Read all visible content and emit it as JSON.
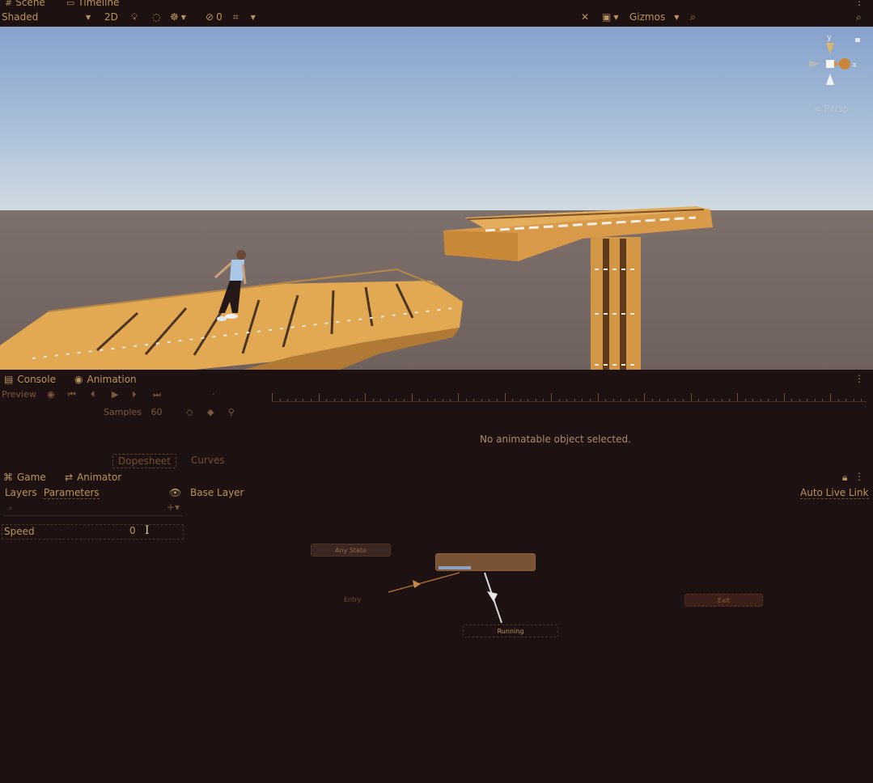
{
  "scene_tabs": [
    {
      "label": "Scene",
      "icon": "grid-icon"
    },
    {
      "label": "Timeline",
      "icon": "timeline-icon"
    }
  ],
  "scene_toolbar": {
    "draw_mode": "Shaded",
    "mode_2d": "2D",
    "hidden_count": "0",
    "gizmos_label": "Gizmos"
  },
  "viewport": {
    "projection_label": "Persp",
    "axis_y": "y",
    "axis_x": "x",
    "sky_top": "#8aa6cf",
    "sky_horizon": "#c8d6e2",
    "ground": "#766865",
    "structure_color": "#e0a653"
  },
  "lower_tabs": [
    {
      "label": "Console",
      "icon": "console-icon"
    },
    {
      "label": "Animation",
      "icon": "animation-icon"
    }
  ],
  "animation": {
    "preview_label": "Preview",
    "samples_label": "Samples",
    "samples_value": "60",
    "empty_message": "No animatable object selected.",
    "dopesheet_label": "Dopesheet",
    "curves_label": "Curves"
  },
  "bottom_tabs": [
    {
      "label": "Game",
      "icon": "gamepad-icon"
    },
    {
      "label": "Animator",
      "icon": "animator-icon"
    }
  ],
  "animator": {
    "layers_label": "Layers",
    "parameters_label": "Parameters",
    "base_layer_label": "Base Layer",
    "auto_live_link_label": "Auto Live Link",
    "parameters": [
      {
        "name": "Speed",
        "value": "0"
      }
    ],
    "nodes": {
      "any_state": "Any State",
      "entry": "Entry",
      "exit": "Exit",
      "running": "Running"
    }
  }
}
